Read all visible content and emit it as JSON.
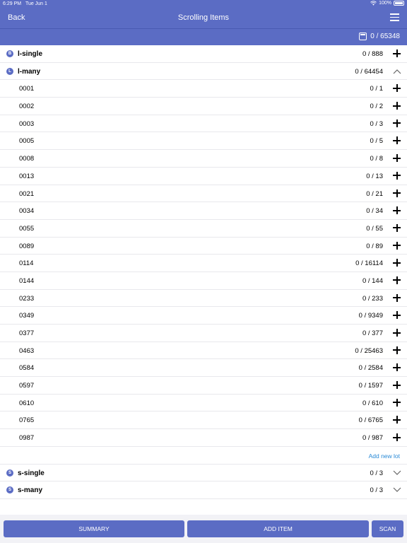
{
  "status_bar": {
    "time": "6:29 PM",
    "date": "Tue Jun 1",
    "battery": "100%"
  },
  "nav": {
    "back_label": "Back",
    "title": "Scrolling Items"
  },
  "totals": {
    "text": "0 / 65348"
  },
  "groups": [
    {
      "badge": "B",
      "name": "l-single",
      "count": "0 / 888",
      "state": "collapsed-plus"
    },
    {
      "badge": "L",
      "name": "l-many",
      "count": "0 /   64454",
      "state": "expanded"
    }
  ],
  "items": [
    {
      "name": "0001",
      "count": "0 /     1"
    },
    {
      "name": "0002",
      "count": "0 /     2"
    },
    {
      "name": "0003",
      "count": "0 /     3"
    },
    {
      "name": "0005",
      "count": "0 /     5"
    },
    {
      "name": "0008",
      "count": "0 /     8"
    },
    {
      "name": "0013",
      "count": "0 /    13"
    },
    {
      "name": "0021",
      "count": "0 /    21"
    },
    {
      "name": "0034",
      "count": "0 /    34"
    },
    {
      "name": "0055",
      "count": "0 /    55"
    },
    {
      "name": "0089",
      "count": "0 /    89"
    },
    {
      "name": "0114",
      "count": "0 /  16114"
    },
    {
      "name": "0144",
      "count": "0 / 144"
    },
    {
      "name": "0233",
      "count": "0 / 233"
    },
    {
      "name": "0349",
      "count": "0 /  9349"
    },
    {
      "name": "0377",
      "count": "0 / 377"
    },
    {
      "name": "0463",
      "count": "0 /  25463"
    },
    {
      "name": "0584",
      "count": "0 /  2584"
    },
    {
      "name": "0597",
      "count": "0 /  1597"
    },
    {
      "name": "0610",
      "count": "0 / 610"
    },
    {
      "name": "0765",
      "count": "0 /  6765"
    },
    {
      "name": "0987",
      "count": "0 / 987"
    }
  ],
  "add_new_lot": "Add new lot",
  "bottom_groups": [
    {
      "badge": "S",
      "name": "s-single",
      "count": "0 /    3"
    },
    {
      "badge": "S",
      "name": "s-many",
      "count": "0 /    3"
    }
  ],
  "footer": {
    "summary": "SUMMARY",
    "add_item": "ADD ITEM",
    "scan": "SCAN"
  },
  "colors": {
    "accent": "#5b6cc4",
    "link": "#2a8ad6",
    "footer_bg": "#f2f2f6"
  }
}
